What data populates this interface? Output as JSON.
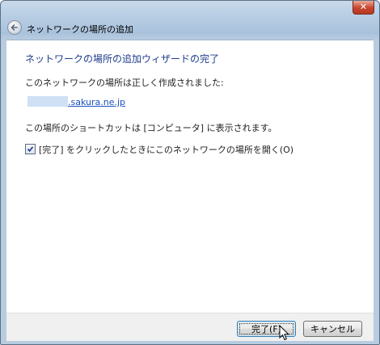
{
  "window": {
    "title": "ネットワークの場所の追加",
    "close_label": "✕"
  },
  "content": {
    "heading": "ネットワークの場所の追加ウィザードの完了",
    "created_message": "このネットワークの場所は正しく作成されました:",
    "location_link": ".sakura.ne.jp",
    "shortcut_message": "この場所のショートカットは [コンピュータ] に表示されます。",
    "open_checkbox": {
      "label": "[完了] をクリックしたときにこのネットワークの場所を開く(O)",
      "checked": true
    }
  },
  "footer": {
    "finish_label": "完了(F)",
    "cancel_label": "キャンセル"
  },
  "colors": {
    "heading": "#1d3c8a",
    "link": "#1a4fbf",
    "close_button": "#c8442c"
  }
}
